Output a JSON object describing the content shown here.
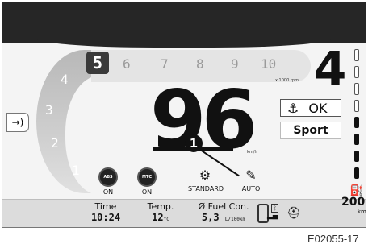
{
  "rpm": {
    "active_gear_label": "5",
    "scale": [
      "6",
      "7",
      "8",
      "9",
      "10"
    ],
    "unit": "x 1000 rpm"
  },
  "arc_numbers": [
    "4",
    "3",
    "2",
    "1"
  ],
  "gear": "4",
  "speed": {
    "value": "96",
    "unit": "km/h"
  },
  "marker": "1",
  "status": {
    "ok_label": "OK",
    "ok_icon": "anchor-icon"
  },
  "riding_mode": "Sport",
  "indicators": [
    {
      "icon": "ABS",
      "label": "ON"
    },
    {
      "icon": "MTC",
      "label": "ON"
    },
    {
      "icon": "engine-map-icon",
      "label": "STANDARD"
    },
    {
      "icon": "auto-shift-icon",
      "label": "AUTO"
    }
  ],
  "info": {
    "time_title": "Time",
    "time_value": "10:24",
    "temp_title": "Temp.",
    "temp_value": "12",
    "temp_unit": "°C",
    "fuel_title": "Ø Fuel Con.",
    "fuel_value": "5,3",
    "fuel_unit": "L/100km"
  },
  "range": {
    "value": "200",
    "unit": "km"
  },
  "fuel_level": 0.6,
  "figure_code": "E02055-17"
}
